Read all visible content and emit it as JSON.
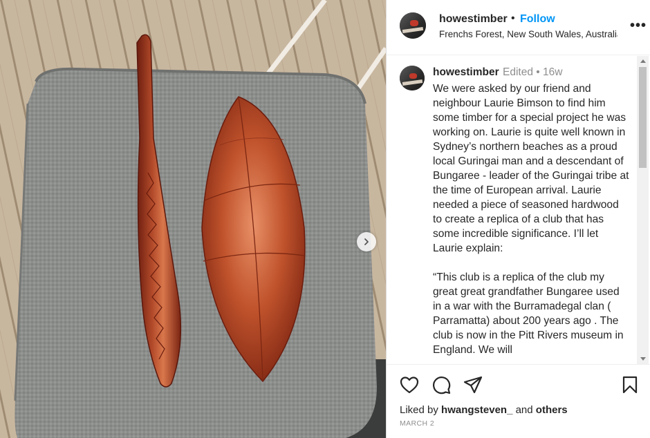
{
  "post": {
    "username": "howestimber",
    "header_separator": "•",
    "follow_label": "Follow",
    "location": "Frenchs Forest, New South Wales, Australia",
    "more_label": "•••"
  },
  "caption": {
    "username": "howestimber",
    "meta": "Edited  •  16w",
    "text": "We were asked by our friend and neighbour Laurie Bimson to find him some timber for a special project he was working on. Laurie is quite well known in Sydney’s northern beaches as a proud local Guringai man and a descendant of Bungaree - leader of the Guringai tribe at the time of European arrival. Laurie needed a piece of seasoned hardwood to create a replica of a club that has some incredible significance. I’ll let Laurie explain:\n\n“This club is a replica of the club my great great grandfather Bungaree used in a war with the Burramadegal clan ( Parramatta) about 200 years ago . The club is now in the Pitt Rivers museum in England. We will"
  },
  "engagement": {
    "liked_prefix": "Liked by ",
    "liked_user": "hwangsteven_",
    "liked_and": " and ",
    "liked_others": "others",
    "date": "MARCH 2"
  },
  "icons": {
    "like": "heart-icon",
    "comment": "comment-icon",
    "share": "send-icon",
    "save": "bookmark-icon",
    "next": "chevron-right-icon",
    "more": "more-icon"
  },
  "colors": {
    "follow": "#0095f6",
    "text": "#262626",
    "muted": "#8e8e8e"
  }
}
